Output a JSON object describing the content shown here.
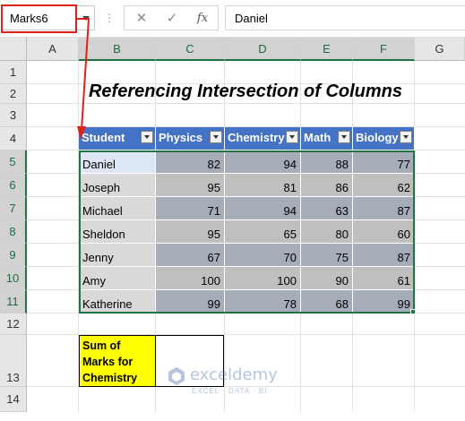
{
  "formula_bar": {
    "name_box": "Marks6",
    "separator": "⋮",
    "cancel_glyph": "✕",
    "enter_glyph": "✓",
    "fx_glyph": "fx",
    "formula": "Daniel"
  },
  "columns": [
    "A",
    "B",
    "C",
    "D",
    "E",
    "F",
    "G"
  ],
  "rows": [
    "1",
    "2",
    "3",
    "4",
    "5",
    "6",
    "7",
    "8",
    "9",
    "10",
    "11",
    "12",
    "13",
    "14"
  ],
  "title": "Referencing Intersection of Columns",
  "table": {
    "headers": [
      "Student",
      "Physics",
      "Chemistry",
      "Math",
      "Biology"
    ],
    "rows": [
      [
        "Daniel",
        "82",
        "94",
        "88",
        "77"
      ],
      [
        "Joseph",
        "95",
        "81",
        "86",
        "62"
      ],
      [
        "Michael",
        "71",
        "94",
        "63",
        "87"
      ],
      [
        "Sheldon",
        "95",
        "65",
        "80",
        "60"
      ],
      [
        "Jenny",
        "67",
        "70",
        "75",
        "87"
      ],
      [
        "Amy",
        "100",
        "100",
        "90",
        "61"
      ],
      [
        "Katherine",
        "99",
        "78",
        "68",
        "99"
      ]
    ]
  },
  "sum_box": {
    "label": "Sum of Marks for Chemistry",
    "value": ""
  },
  "watermark": {
    "name": "exceldemy",
    "tagline": "EXCEL · DATA · BI"
  },
  "colors": {
    "header_blue": "#4472c4",
    "selection_green": "#217346",
    "callout_red": "#e0201b",
    "sum_label_yellow": "#ffff00"
  }
}
